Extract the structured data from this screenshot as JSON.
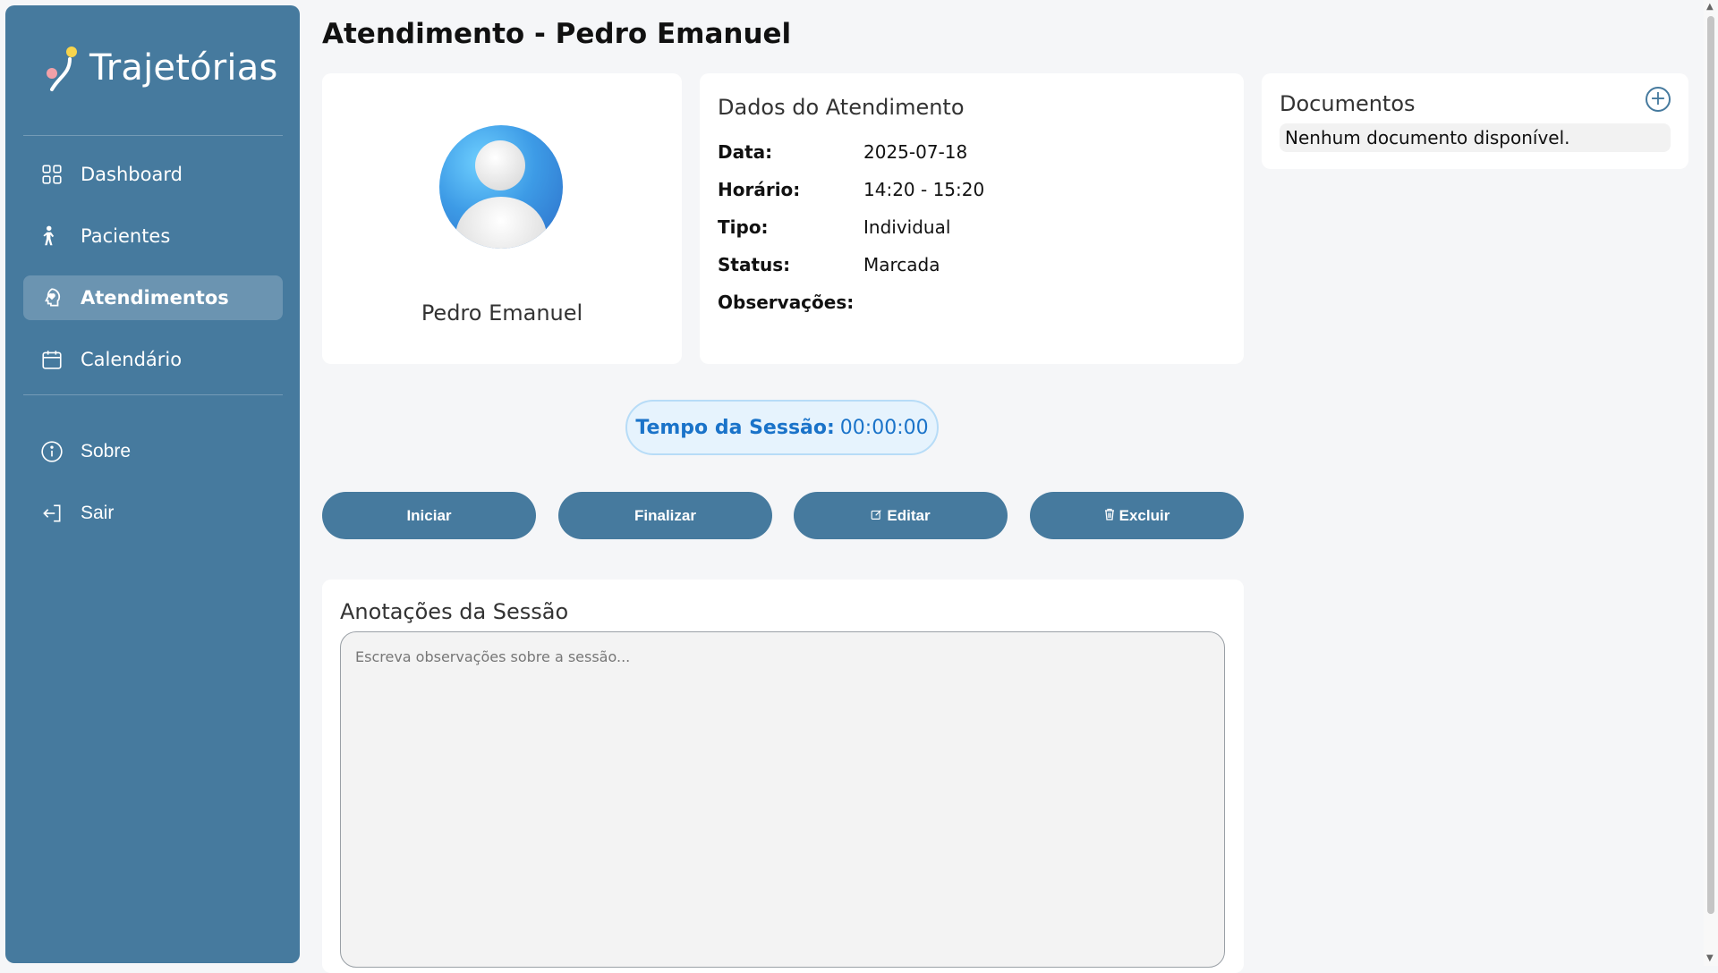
{
  "brand": {
    "name": "Trajetórias",
    "logo_icon": "trajectory-logo-icon"
  },
  "sidebar": {
    "items": [
      {
        "label": "Dashboard",
        "icon": "grid-icon",
        "active": false
      },
      {
        "label": "Pacientes",
        "icon": "person-icon",
        "active": false
      },
      {
        "label": "Atendimentos",
        "icon": "head-heart-icon",
        "active": true
      },
      {
        "label": "Calendário",
        "icon": "calendar-icon",
        "active": false
      },
      {
        "label": "Sobre",
        "icon": "info-icon",
        "active": false
      },
      {
        "label": "Sair",
        "icon": "logout-icon",
        "active": false
      }
    ]
  },
  "page": {
    "title": "Atendimento - Pedro Emanuel"
  },
  "patient": {
    "name": "Pedro Emanuel",
    "avatar_icon": "user-avatar-icon"
  },
  "appointment": {
    "title": "Dados do Atendimento",
    "fields": [
      {
        "label": "Data:",
        "value": "2025-07-18"
      },
      {
        "label": "Horário:",
        "value": "14:20 - 15:20"
      },
      {
        "label": "Tipo:",
        "value": "Individual"
      },
      {
        "label": "Status:",
        "value": "Marcada"
      },
      {
        "label": "Observações:",
        "value": ""
      }
    ]
  },
  "documents": {
    "title": "Documentos",
    "add_symbol": "+",
    "empty_text": "Nenhum documento disponível."
  },
  "timer": {
    "label": "Tempo da Sessão:",
    "value": "00:00:00"
  },
  "actions": {
    "start": "Iniciar",
    "finish": "Finalizar",
    "edit": "Editar",
    "delete": "Excluir"
  },
  "notes": {
    "title": "Anotações da Sessão",
    "placeholder": "Escreva observações sobre a sessão...",
    "value": ""
  },
  "colors": {
    "sidebar": "#467a9e",
    "button": "#467a9e",
    "timer_text": "#1a73c9",
    "timer_bg": "#e6f3fd"
  }
}
